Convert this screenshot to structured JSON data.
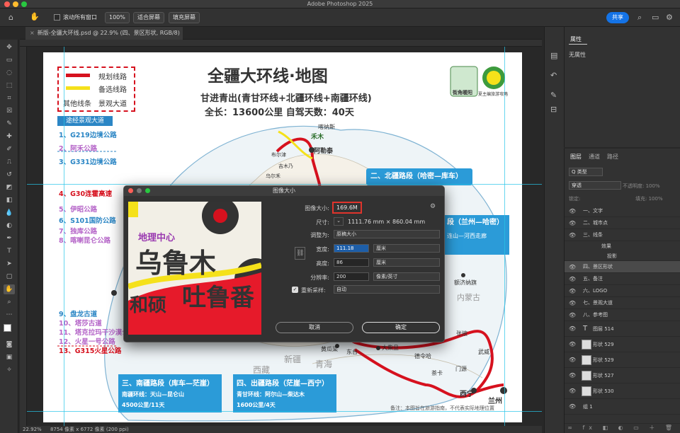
{
  "app": {
    "title": "Adobe Photoshop 2025"
  },
  "options": {
    "scroll_all": "滚动所有窗口",
    "zoom": "100%",
    "fit_screen": "适合屏幕",
    "fill_screen": "填充屏幕",
    "share": "共享"
  },
  "doc_tab": {
    "label": "新版-全疆大环线.psd @ 22.9% (四、景区形状, RGB/8) *"
  },
  "status": {
    "zoom": "22.92%",
    "dims": "8754 像素 x 6772 像素 (200 ppi)"
  },
  "panels": {
    "properties_tab": "属性",
    "properties_empty": "无属性",
    "layers_tabs": [
      "图层",
      "通道",
      "路径"
    ],
    "kind": "Q 类型",
    "blend": "穿透",
    "opacity": "不透明度: 100%",
    "lock": "锁定:",
    "fill": "填充: 100%"
  },
  "layers": [
    {
      "name": "一、文字",
      "type": "group"
    },
    {
      "name": "二、城市点",
      "type": "group"
    },
    {
      "name": "三、线条",
      "type": "group"
    },
    {
      "name": "效果",
      "type": "sub"
    },
    {
      "name": "投影",
      "type": "sub"
    },
    {
      "name": "四、景区形状",
      "type": "group"
    },
    {
      "name": "五、备注",
      "type": "group"
    },
    {
      "name": "六、LOGO",
      "type": "group"
    },
    {
      "name": "七、景观大道",
      "type": "group"
    },
    {
      "name": "八、参考图",
      "type": "group"
    },
    {
      "name": "图层 514",
      "type": "text"
    },
    {
      "name": "形状 529",
      "type": "shape"
    },
    {
      "name": "形状 529",
      "type": "shape"
    },
    {
      "name": "形状 527",
      "type": "shape"
    },
    {
      "name": "形状 530",
      "type": "shape"
    },
    {
      "name": "组 1",
      "type": "group"
    }
  ],
  "map": {
    "title": "全疆大环线·地图",
    "subtitle": "甘进青出(青甘环线+北疆环线+南疆环线)",
    "length": "全长：13600公里  自驾天数：40天",
    "legend": [
      "规划线路",
      "备选线路",
      "其他线条",
      "景观大道"
    ],
    "scenic_header": "途经景观大道",
    "roads": [
      "1、G219边境公路",
      "2、阿禾公路",
      "3、G331边境公路",
      "4、G30连霍高速",
      "5、伊昭公路",
      "6、S101国防公路",
      "7、独库公路",
      "8、喀喇昆仑公路",
      "9、盘龙古道",
      "10、塔莎古道",
      "11、塔克拉玛干沙漠公路",
      "12、火星一号公路",
      "13、G315火星公路"
    ],
    "north_section": "二、北疆路段（哈密—库车）",
    "gansu_section": "段（兰州—哈密）",
    "gansu_sub": "连山—河西走廊",
    "south_section": "三、南疆路段（库车—茫崖）",
    "south_loop": "南疆环线：天山—昆仑山",
    "south_days": "4500公里/11天",
    "exit_section": "四、出疆路段（茫崖—西宁）",
    "qinggan": "青甘环线：阿尔山—柴达木",
    "exit_days": "1600公里/4天",
    "note": "备注：本图旨在旅游指南，不代表实际地理位置",
    "cities": [
      "喀纳斯",
      "禾木",
      "阿勒泰",
      "兰州",
      "西宁",
      "门源",
      "武威",
      "张掖",
      "额济纳旗",
      "内蒙古",
      "茶卡",
      "东台",
      "大柴旦",
      "德令哈",
      "黄瓜梁",
      "新疆",
      "青海",
      "西藏",
      "乌尔禾",
      "布尔津",
      "吉木乃"
    ],
    "logo1": "街角暖阳",
    "logo2": "夏主编旅游攻略"
  },
  "dialog": {
    "title": "图像大小",
    "size_label": "图像大小:",
    "size_value": "169.6M",
    "dims_label": "尺寸:",
    "dims_value": "1111.76 mm × 860.04 mm",
    "fit_label": "调整为:",
    "fit_value": "原稿大小",
    "width_label": "宽度:",
    "width_value": "111.18",
    "width_unit": "厘米",
    "height_label": "高度:",
    "height_value": "86",
    "height_unit": "厘米",
    "res_label": "分辨率:",
    "res_value": "200",
    "res_unit": "像素/英寸",
    "resample_label": "重新采样:",
    "resample_value": "自动",
    "cancel": "取消",
    "ok": "确定",
    "preview_text": [
      "乌鲁木",
      "吐鲁番",
      "和硕",
      "地理中心"
    ]
  }
}
